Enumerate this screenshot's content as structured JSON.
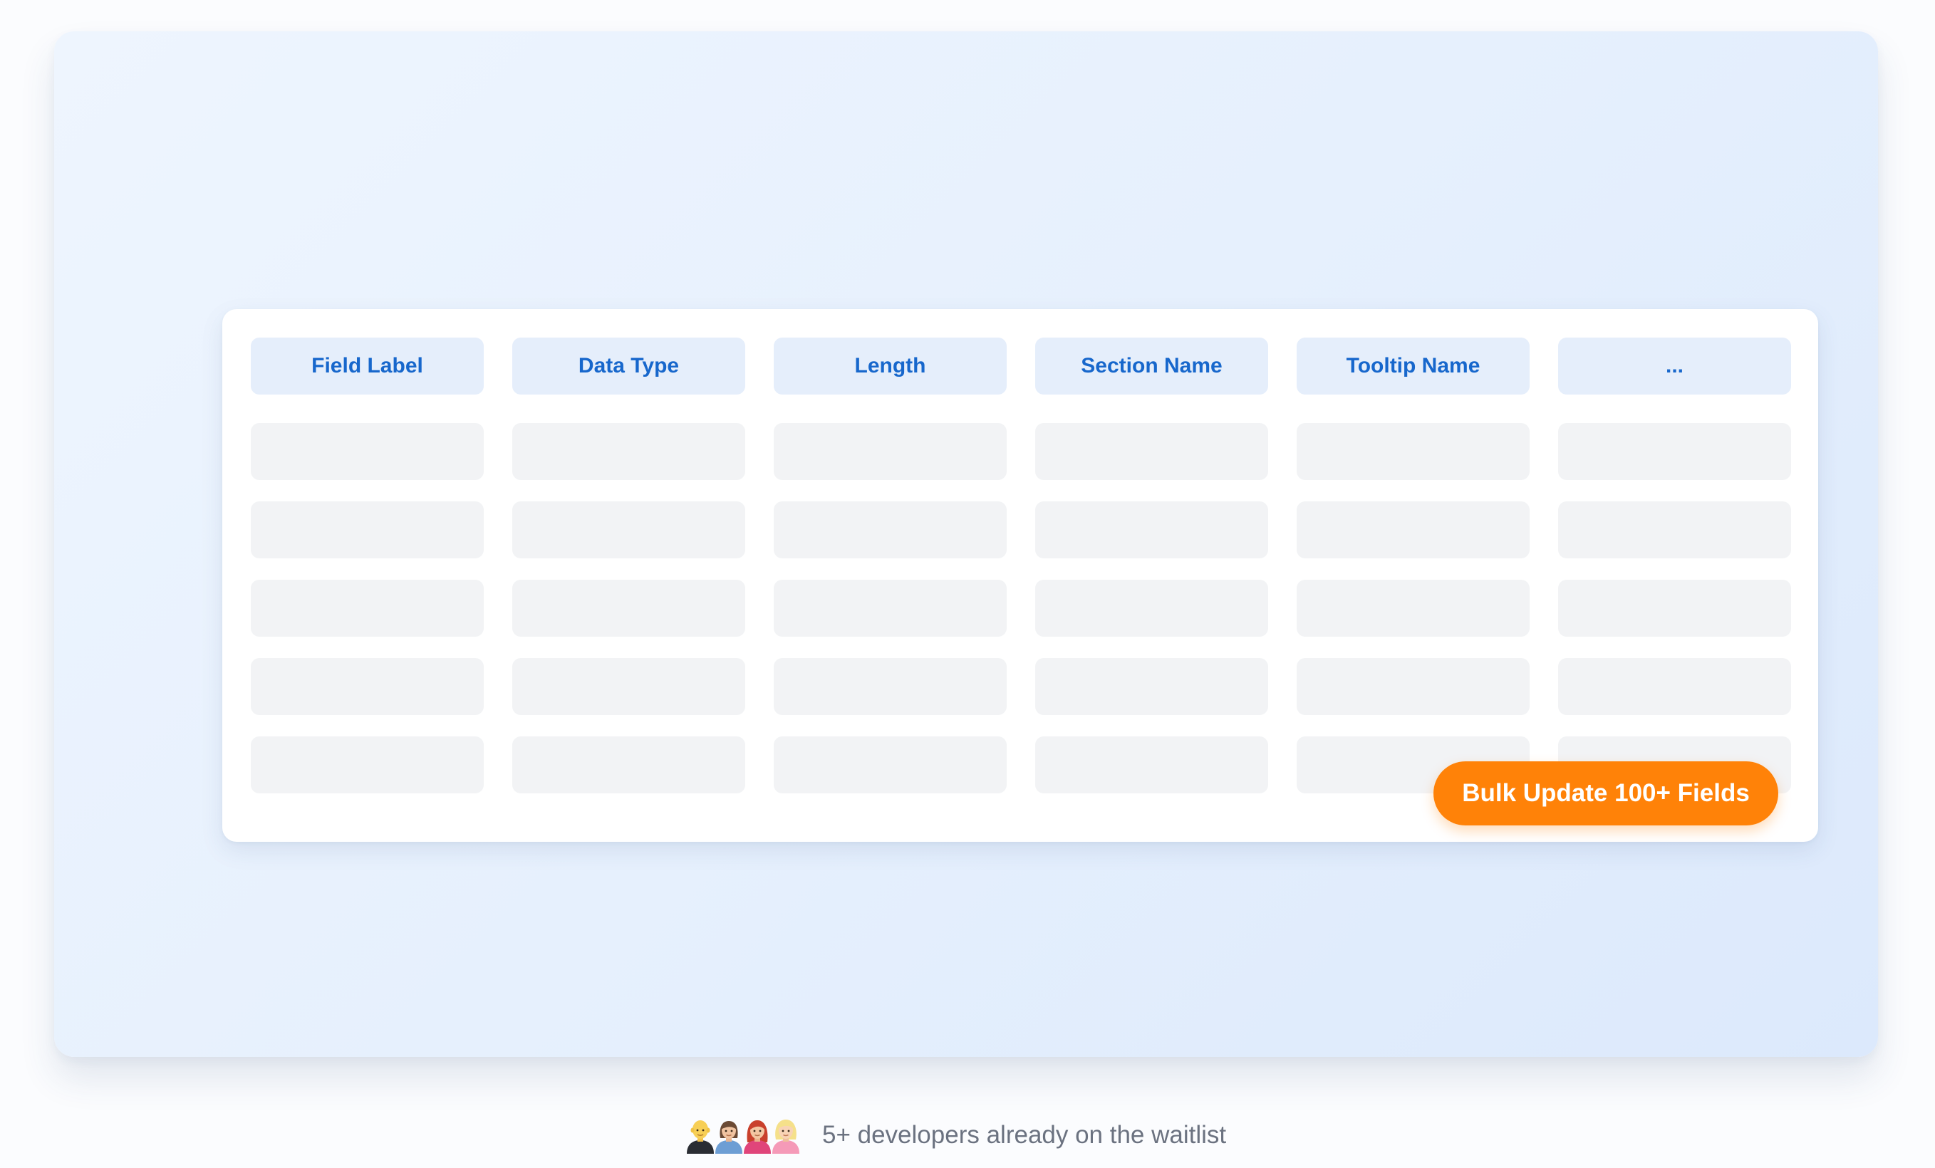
{
  "table": {
    "headers": [
      "Field Label",
      "Data Type",
      "Length",
      "Section Name",
      "Tooltip Name",
      "..."
    ],
    "row_count": 5
  },
  "cta": {
    "label": "Bulk Update 100+ Fields"
  },
  "waitlist": {
    "text": "5+ developers already on the waitlist",
    "avatars": [
      "avatar-bald-man-icon",
      "avatar-woman-icon",
      "avatar-red-hair-woman-icon",
      "avatar-blonde-woman-icon"
    ]
  },
  "colors": {
    "accent": "#ff8208",
    "header_text": "#1767cc",
    "header_bg": "#e5eefb",
    "placeholder_bg": "#f2f3f5"
  }
}
